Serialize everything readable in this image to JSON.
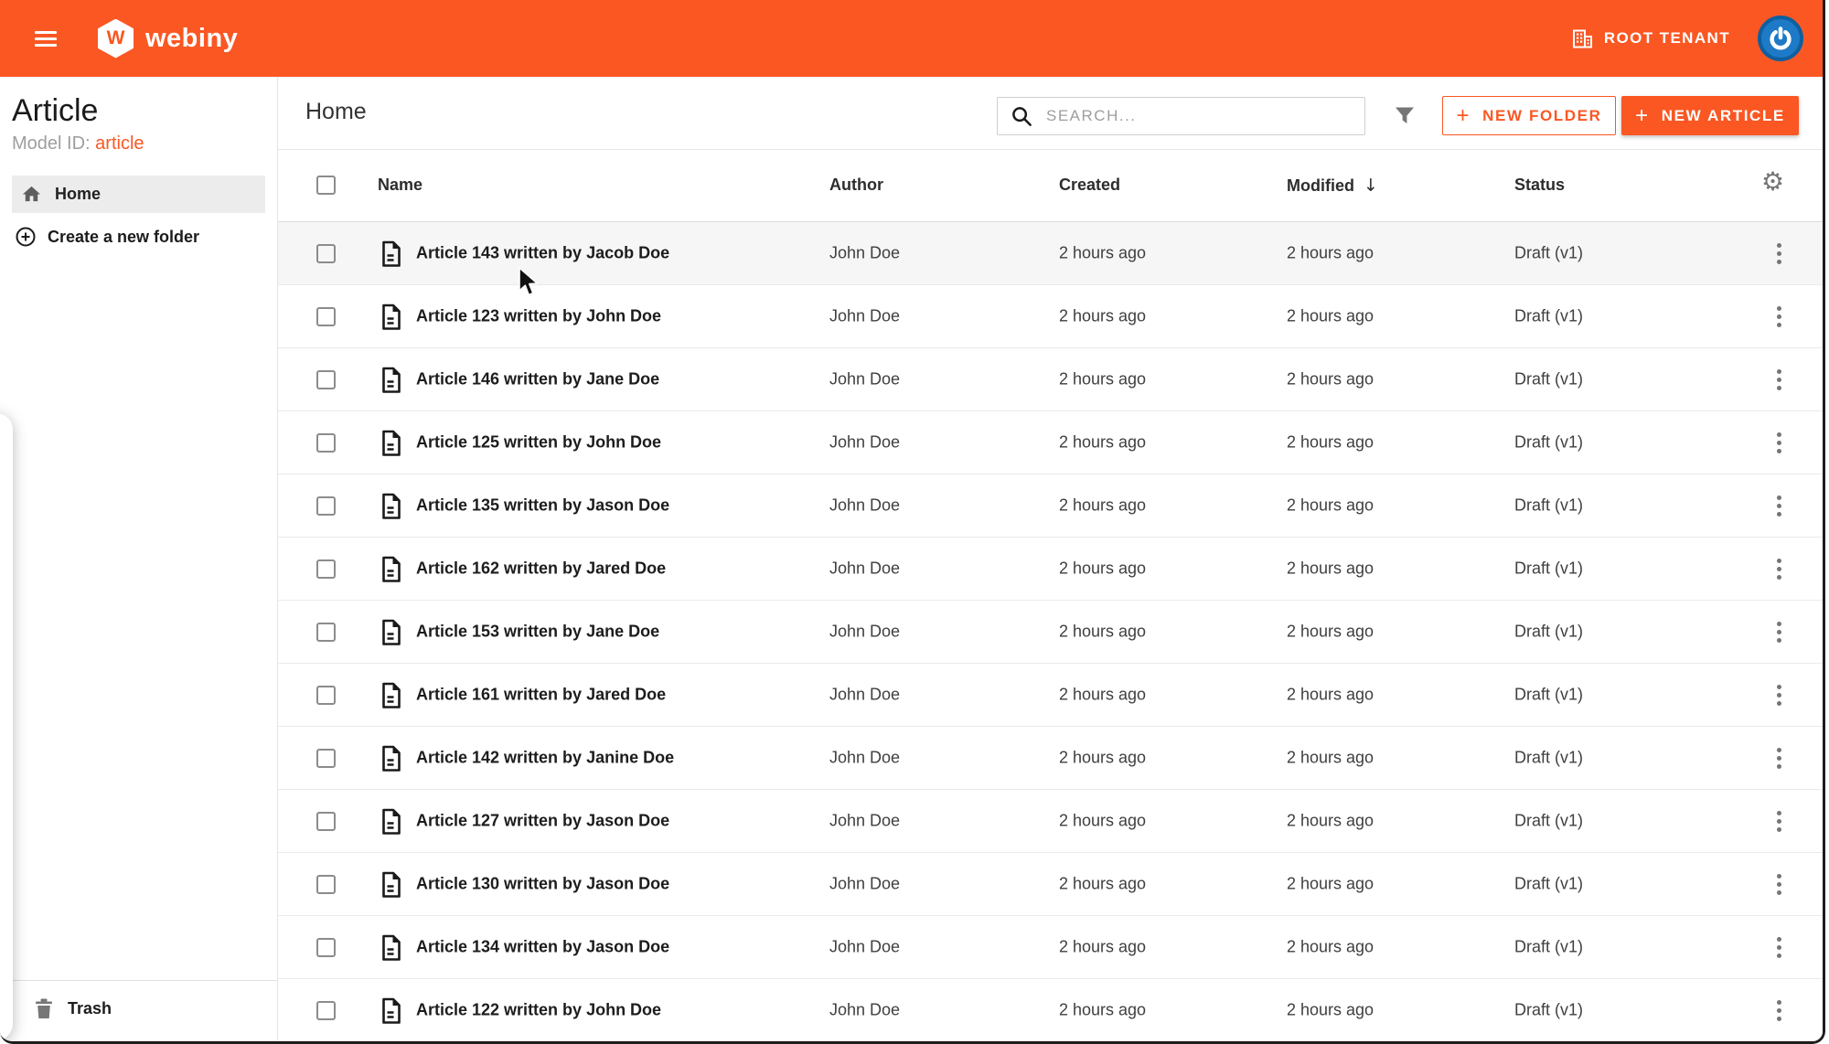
{
  "topbar": {
    "brand_letter": "W",
    "brand_name": "webiny",
    "tenant_label": "ROOT TENANT"
  },
  "sidebar": {
    "title": "Article",
    "model_id_label": "Model ID:",
    "model_id_value": "article",
    "home_label": "Home",
    "create_folder_label": "Create a new folder",
    "trash_label": "Trash"
  },
  "toolbar": {
    "breadcrumb": "Home",
    "search_placeholder": "SEARCH...",
    "plus": "+",
    "new_folder_label": "NEW FOLDER",
    "new_article_label": "NEW ARTICLE"
  },
  "table": {
    "columns": {
      "name": "Name",
      "author": "Author",
      "created": "Created",
      "modified": "Modified",
      "status": "Status"
    },
    "sort": {
      "column": "Modified",
      "direction": "descending",
      "arrow": "↓"
    },
    "rows": [
      {
        "name": "Article 143 written by Jacob Doe",
        "author": "John Doe",
        "created": "2 hours ago",
        "modified": "2 hours ago",
        "status": "Draft (v1)",
        "hovered": true
      },
      {
        "name": "Article 123 written by John Doe",
        "author": "John Doe",
        "created": "2 hours ago",
        "modified": "2 hours ago",
        "status": "Draft (v1)",
        "hovered": false
      },
      {
        "name": "Article 146 written by Jane Doe",
        "author": "John Doe",
        "created": "2 hours ago",
        "modified": "2 hours ago",
        "status": "Draft (v1)",
        "hovered": false
      },
      {
        "name": "Article 125 written by John Doe",
        "author": "John Doe",
        "created": "2 hours ago",
        "modified": "2 hours ago",
        "status": "Draft (v1)",
        "hovered": false
      },
      {
        "name": "Article 135 written by Jason Doe",
        "author": "John Doe",
        "created": "2 hours ago",
        "modified": "2 hours ago",
        "status": "Draft (v1)",
        "hovered": false
      },
      {
        "name": "Article 162 written by Jared Doe",
        "author": "John Doe",
        "created": "2 hours ago",
        "modified": "2 hours ago",
        "status": "Draft (v1)",
        "hovered": false
      },
      {
        "name": "Article 153 written by Jane Doe",
        "author": "John Doe",
        "created": "2 hours ago",
        "modified": "2 hours ago",
        "status": "Draft (v1)",
        "hovered": false
      },
      {
        "name": "Article 161 written by Jared Doe",
        "author": "John Doe",
        "created": "2 hours ago",
        "modified": "2 hours ago",
        "status": "Draft (v1)",
        "hovered": false
      },
      {
        "name": "Article 142 written by Janine Doe",
        "author": "John Doe",
        "created": "2 hours ago",
        "modified": "2 hours ago",
        "status": "Draft (v1)",
        "hovered": false
      },
      {
        "name": "Article 127 written by Jason Doe",
        "author": "John Doe",
        "created": "2 hours ago",
        "modified": "2 hours ago",
        "status": "Draft (v1)",
        "hovered": false
      },
      {
        "name": "Article 130 written by Jason Doe",
        "author": "John Doe",
        "created": "2 hours ago",
        "modified": "2 hours ago",
        "status": "Draft (v1)",
        "hovered": false
      },
      {
        "name": "Article 134 written by Jason Doe",
        "author": "John Doe",
        "created": "2 hours ago",
        "modified": "2 hours ago",
        "status": "Draft (v1)",
        "hovered": false
      },
      {
        "name": "Article 122 written by John Doe",
        "author": "John Doe",
        "created": "2 hours ago",
        "modified": "2 hours ago",
        "status": "Draft (v1)",
        "hovered": false
      }
    ]
  },
  "colors": {
    "primary": "#FA5723",
    "topbar_bg": "#FA5723",
    "avatar_blue": "#1E7AC6",
    "row_hover": "#F6F6F6",
    "model_link": "#FA5723"
  }
}
